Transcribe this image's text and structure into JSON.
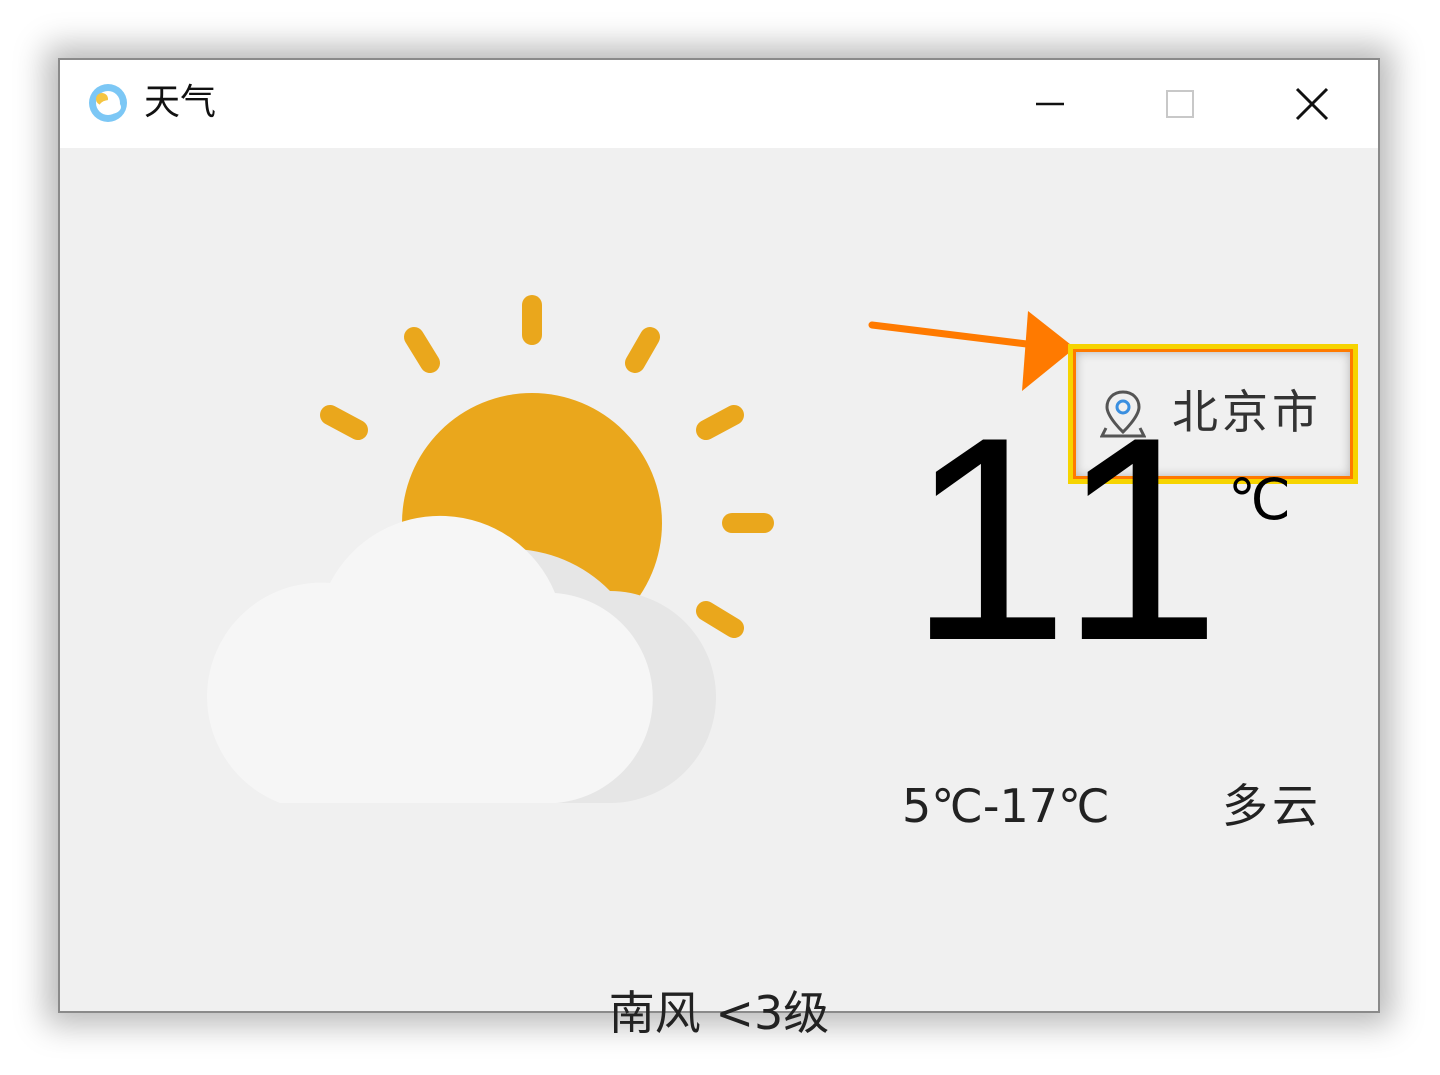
{
  "window": {
    "title": "天气"
  },
  "location": {
    "name": "北京市"
  },
  "weather": {
    "current_temp": "11",
    "unit": "℃",
    "range": "5℃-17℃",
    "condition": "多云",
    "wind": "南风 <3级",
    "icon": "partly-cloudy-icon"
  },
  "colors": {
    "sun": "#EAA71C",
    "cloud": "#F6F6F6",
    "cloud_shadow": "#E6E6E6",
    "highlight_border": "#F6D400",
    "highlight_inner": "#FF7A00",
    "arrow": "#FF7A00"
  }
}
